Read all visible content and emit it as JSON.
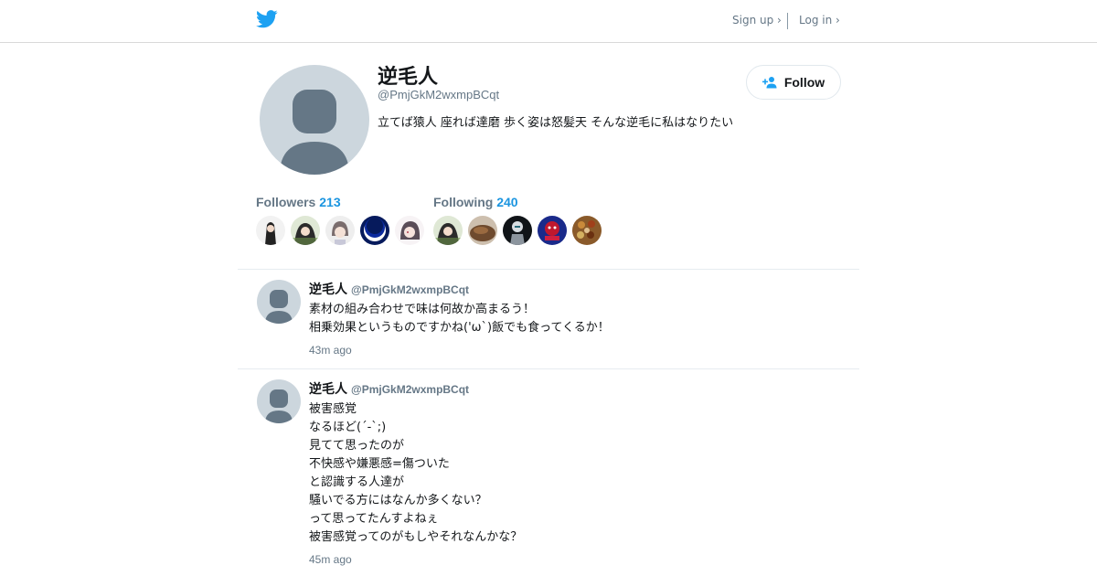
{
  "header": {
    "signup_label": "Sign up ›",
    "login_label": "Log in ›",
    "logo_icon": "twitter-bird-icon",
    "logo_color": "#1da1f2"
  },
  "profile": {
    "display_name": "逆毛人",
    "handle": "@PmjGkM2wxmpBCqt",
    "bio": "立てば猿人 座れば達磨 歩く姿は怒髪天 そんな逆毛に私はなりたい",
    "follow_label": "Follow",
    "follow_icon": "follow-user-plus-icon",
    "followers_label": "Followers",
    "followers_count": "213",
    "following_label": "Following",
    "following_count": "240"
  },
  "tweets": [
    {
      "name": "逆毛人",
      "handle": "@PmjGkM2wxmpBCqt",
      "lines": [
        "素材の組み合わせで味は何故か高まるう！",
        "相乗効果というものですかね('ω`)飯でも食ってくるか！"
      ],
      "time": "43m ago"
    },
    {
      "name": "逆毛人",
      "handle": "@PmjGkM2wxmpBCqt",
      "lines": [
        "被害感覚",
        "なるほど(´-`;)",
        "見てて思ったのが",
        "不快感や嫌悪感=傷ついた",
        "と認識する人達が",
        "騒いでる方にはなんか多くない？",
        "って思ってたんすよねぇ",
        "被害感覚ってのがもしやそれなんかな？"
      ],
      "time": "45m ago"
    }
  ],
  "colors": {
    "accent": "#1b95e0",
    "muted": "#657786",
    "avatar_bg": "#ccd6dd",
    "avatar_fg": "#657786"
  }
}
